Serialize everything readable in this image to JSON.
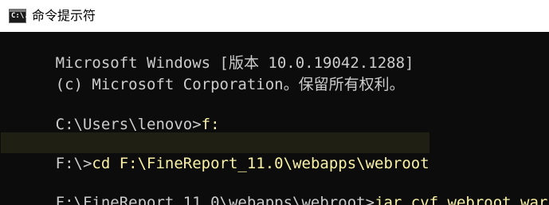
{
  "window": {
    "title": "命令提示符",
    "icon": "cmd-console-icon",
    "icon_glyph": "C:\\."
  },
  "console": {
    "colors": {
      "background": "#0c0c0c",
      "text": "#cccccc",
      "command": "#f9f1a5"
    },
    "lines": [
      {
        "text": "Microsoft Windows [版本 10.0.19042.1288]"
      },
      {
        "text": "(c) Microsoft Corporation。保留所有权利。"
      },
      {
        "prompt": "C:\\Users\\lenovo>",
        "command": "f:"
      },
      {
        "prompt": "F:\\>",
        "command": "cd F:\\FineReport_11.0\\webapps\\webroot"
      },
      {
        "prompt": "F:\\FineReport_11.0\\webapps\\webroot>",
        "command": "jar cvf webroot.war *"
      }
    ]
  }
}
